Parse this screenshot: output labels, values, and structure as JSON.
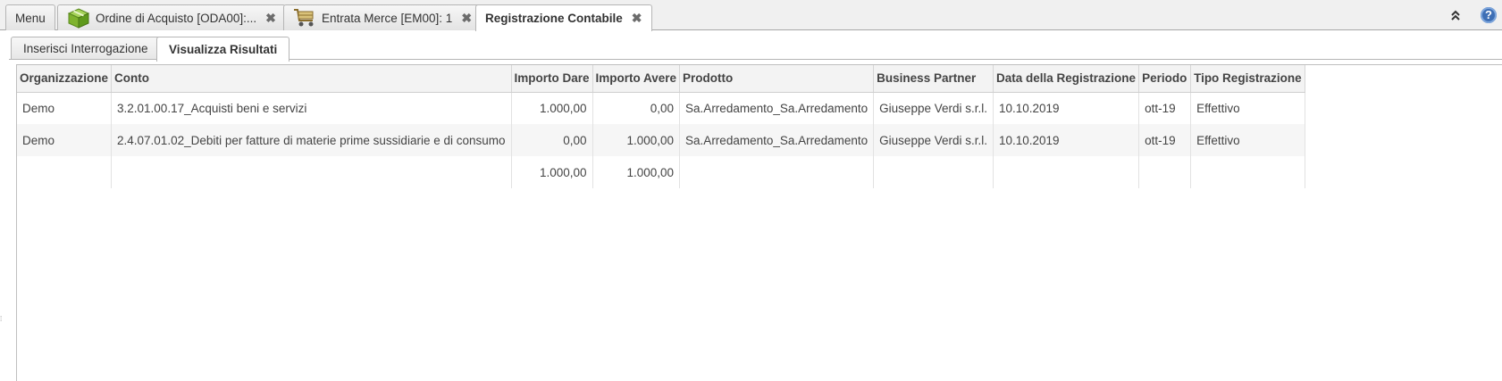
{
  "tabs": [
    {
      "label": "Menu"
    },
    {
      "label": "Ordine di Acquisto [ODA00]:..."
    },
    {
      "label": "Entrata Merce [EM00]: 1"
    },
    {
      "label": "Registrazione Contabile"
    }
  ],
  "help_label": "?",
  "subtabs": [
    {
      "label": "Inserisci Interrogazione"
    },
    {
      "label": "Visualizza Risultati"
    }
  ],
  "columns": [
    "Organizzazione",
    "Conto",
    "Importo Dare",
    "Importo Avere",
    "Prodotto",
    "Business Partner",
    "Data della Registrazione",
    "Periodo",
    "Tipo Registrazione"
  ],
  "rows": [
    [
      "Demo",
      "3.2.01.00.17_Acquisti beni e servizi",
      "1.000,00",
      "0,00",
      "Sa.Arredamento_Sa.Arredamento",
      "Giuseppe Verdi s.r.l.",
      "10.10.2019",
      "ott-19",
      "Effettivo"
    ],
    [
      "Demo",
      "2.4.07.01.02_Debiti per fatture di materie prime sussidiarie e di consumo",
      "0,00",
      "1.000,00",
      "Sa.Arredamento_Sa.Arredamento",
      "Giuseppe Verdi s.r.l.",
      "10.10.2019",
      "ott-19",
      "Effettivo"
    ]
  ],
  "totals": {
    "importo_dare": "1.000,00",
    "importo_avere": "1.000,00"
  },
  "colors": {
    "accent_blue": "#3e6fb5",
    "tab_border": "#b5b5b5"
  }
}
